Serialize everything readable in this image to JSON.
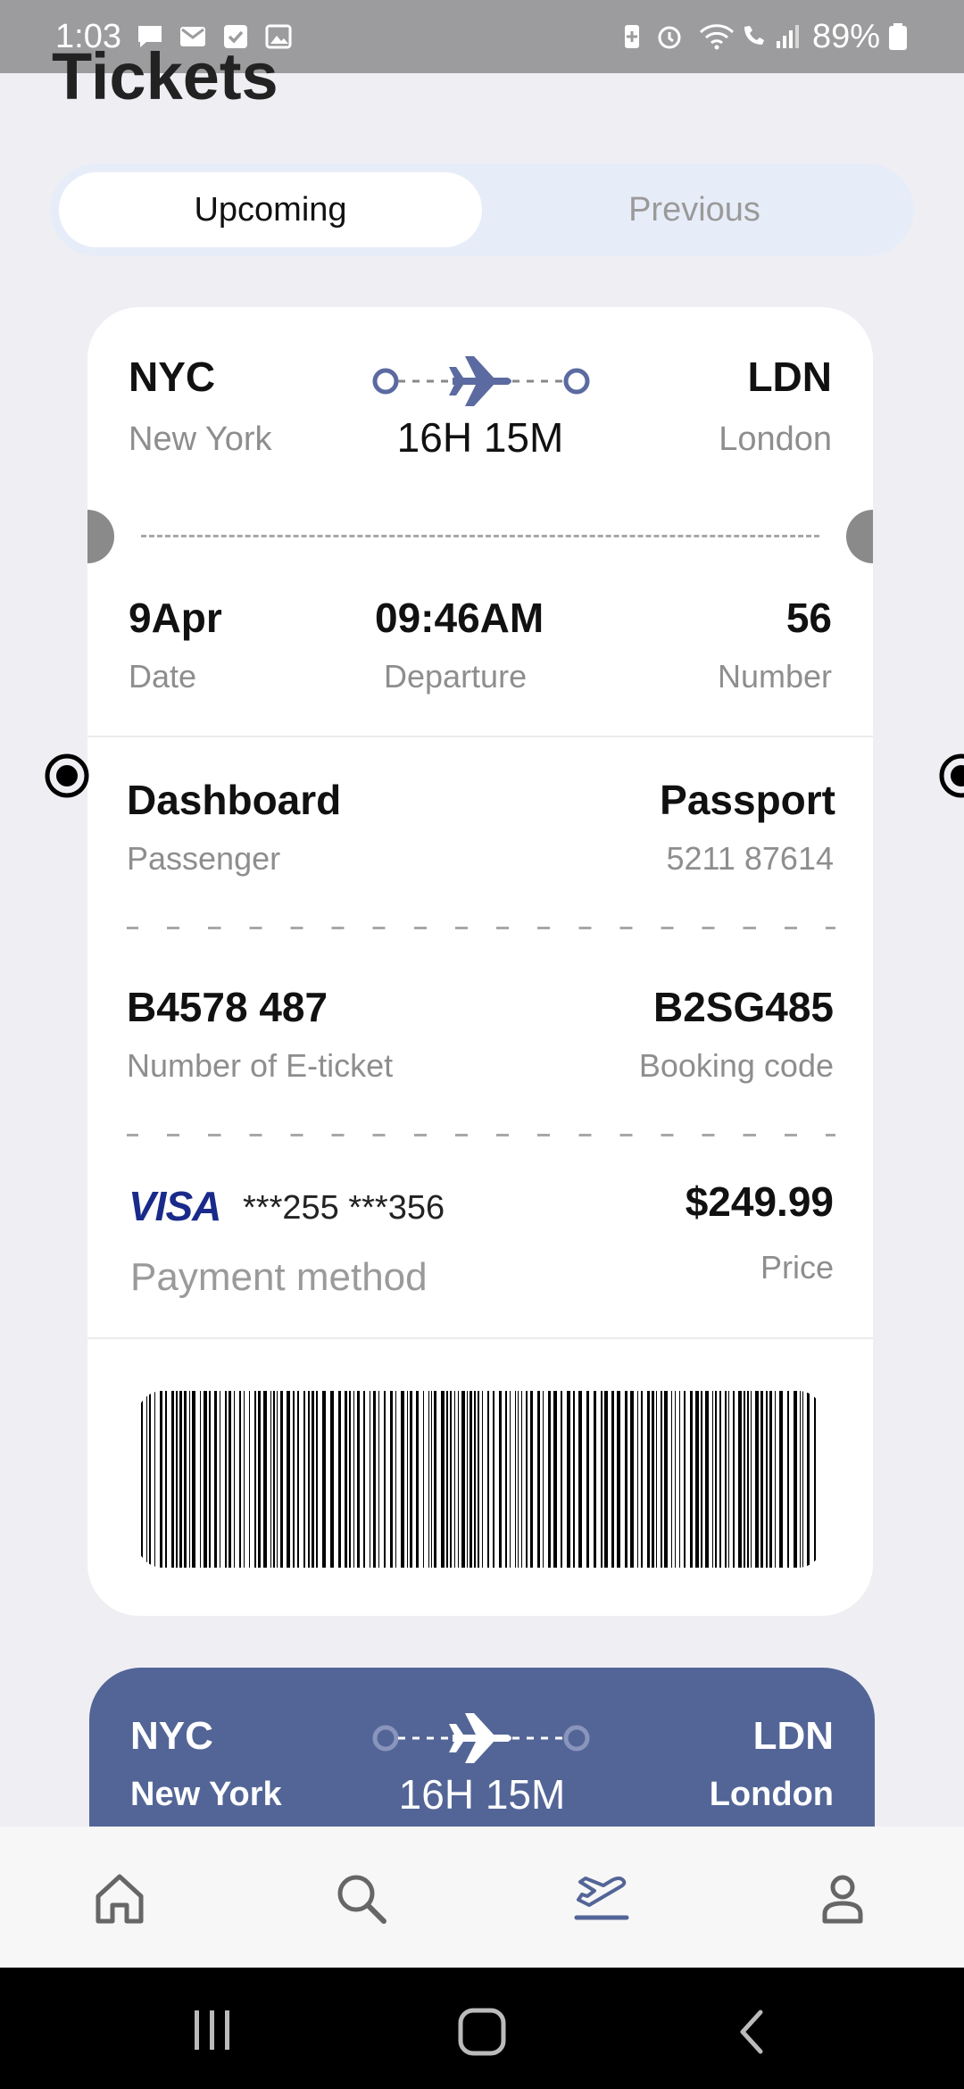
{
  "status_bar": {
    "time": "1:03",
    "battery": "89%"
  },
  "page": {
    "title": "Tickets"
  },
  "tabs": {
    "upcoming": "Upcoming",
    "previous": "Previous"
  },
  "ticket": {
    "from_code": "NYC",
    "from_city": "New York",
    "to_code": "LDN",
    "to_city": "London",
    "duration": "16H 15M",
    "date_value": "9Apr",
    "date_label": "Date",
    "departure_value": "09:46AM",
    "departure_label": "Departure",
    "number_value": "56",
    "number_label": "Number",
    "passenger_value": "Dashboard",
    "passenger_label": "Passenger",
    "passport_label": "Passport",
    "passport_value": "5211 87614",
    "eticket_value": "B4578 487",
    "eticket_label": "Number of E-ticket",
    "booking_value": "B2SG485",
    "booking_label": "Booking code",
    "card_brand": "VISA",
    "card_number": "***255 ***356",
    "payment_label": "Payment method",
    "price_value": "$249.99",
    "price_label": "Price"
  },
  "ticket2": {
    "from_code": "NYC",
    "from_city": "New York",
    "to_code": "LDN",
    "to_city": "London",
    "duration": "16H 15M"
  },
  "bottom_nav": {
    "items": [
      "home-icon",
      "search-icon",
      "flight-tickets-icon",
      "profile-icon"
    ],
    "active": "flight-tickets-icon",
    "accent_color": "#536597"
  },
  "colors": {
    "accent": "#536597",
    "background": "#efeff3"
  }
}
